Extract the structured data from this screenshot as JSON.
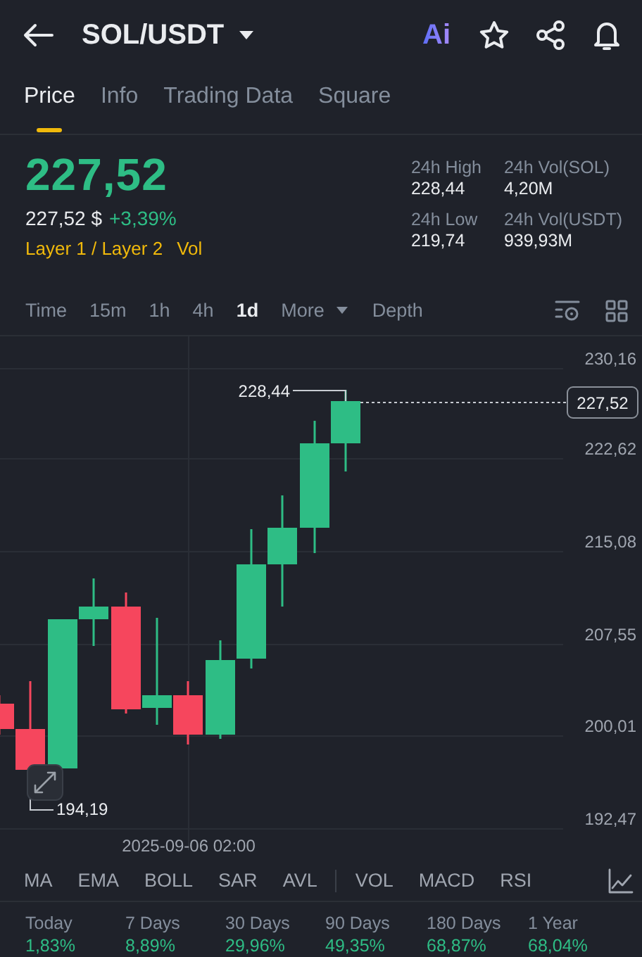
{
  "header": {
    "title": "SOL/USDT",
    "ai_label": "Ai"
  },
  "tabs": [
    {
      "label": "Price",
      "selected": true
    },
    {
      "label": "Info",
      "selected": false
    },
    {
      "label": "Trading Data",
      "selected": false
    },
    {
      "label": "Square",
      "selected": false
    }
  ],
  "price": {
    "last": "227,52",
    "usd": "227,52 $",
    "change": "+3,39%",
    "tags": [
      "Layer 1 / Layer 2",
      "Vol"
    ]
  },
  "stats": [
    {
      "label": "24h High",
      "value": "228,44"
    },
    {
      "label": "24h Vol(SOL)",
      "value": "4,20M"
    },
    {
      "label": "24h Low",
      "value": "219,74"
    },
    {
      "label": "24h Vol(USDT)",
      "value": "939,93M"
    }
  ],
  "intervals": [
    {
      "label": "Time",
      "selected": false
    },
    {
      "label": "15m",
      "selected": false
    },
    {
      "label": "1h",
      "selected": false
    },
    {
      "label": "4h",
      "selected": false
    },
    {
      "label": "1d",
      "selected": true
    }
  ],
  "more": "More",
  "depth": "Depth",
  "chart": {
    "y_labels": [
      "230,16",
      "222,62",
      "215,08",
      "207,55",
      "200,01",
      "192,47"
    ],
    "current_price": "227,52",
    "high_marker": "228,44",
    "low_marker": "194,19",
    "time_label": "2025-09-06 02:00"
  },
  "indicators": [
    {
      "label": "MA",
      "separator_before": false
    },
    {
      "label": "EMA",
      "separator_before": false
    },
    {
      "label": "BOLL",
      "separator_before": false
    },
    {
      "label": "SAR",
      "separator_before": false
    },
    {
      "label": "AVL",
      "separator_before": false
    },
    {
      "label": "VOL",
      "separator_before": true
    },
    {
      "label": "MACD",
      "separator_before": false
    },
    {
      "label": "RSI",
      "separator_before": false
    }
  ],
  "performance": [
    {
      "period": "Today",
      "value": "1,83%"
    },
    {
      "period": "7 Days",
      "value": "8,89%"
    },
    {
      "period": "30 Days",
      "value": "29,96%"
    },
    {
      "period": "90 Days",
      "value": "49,35%"
    },
    {
      "period": "180 Days",
      "value": "68,87%"
    },
    {
      "period": "1 Year",
      "value": "68,04%"
    }
  ]
}
